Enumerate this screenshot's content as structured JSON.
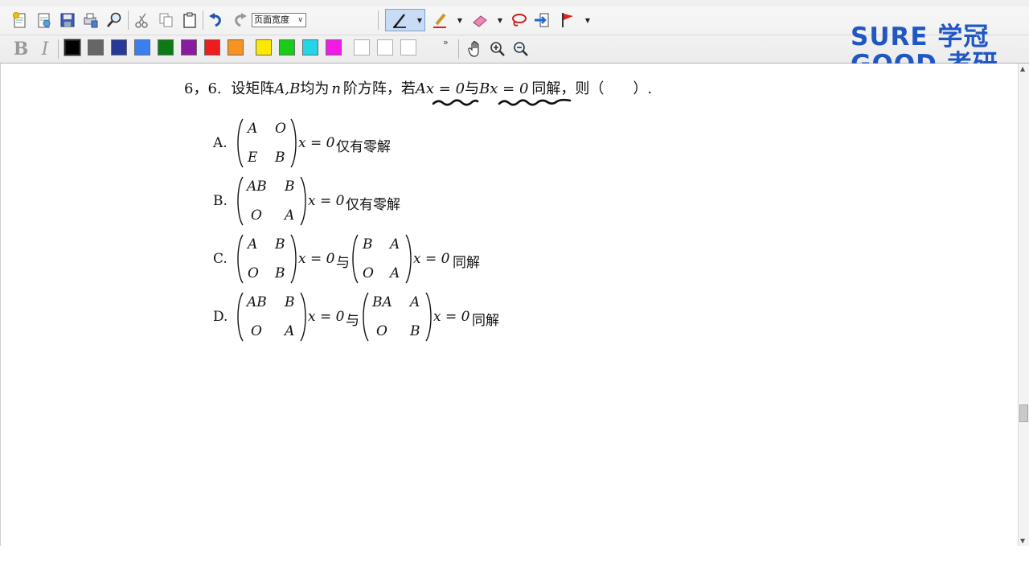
{
  "toolbar": {
    "zoom_selected": "页面宽度",
    "colors": [
      "#000000",
      "#666666",
      "#27389b",
      "#3a7ff0",
      "#0d7a17",
      "#8c1aa0",
      "#ee1c1c",
      "#f7931e",
      "#ffe800",
      "#18cc18",
      "#22d6e8",
      "#f21be6"
    ],
    "more_symbol": "»",
    "bold_label": "B",
    "italic_label": "I"
  },
  "logo": {
    "line1_en": "SURE",
    "line1_cn": "学冠",
    "line2_en": "GOOD",
    "line2_cn": "考研",
    "color": "#1f57c3"
  },
  "question": {
    "number": "6，6.",
    "stem_1": "设矩阵",
    "AB": "A,B",
    "stem_2": "均为",
    "n": "n",
    "stem_3": "阶方阵，若",
    "eq1": "Ax = 0",
    "with": "与",
    "eq2": "Bx = 0",
    "stem_4": "同解，则（　　）."
  },
  "options": [
    {
      "label": "A.",
      "matrix": [
        "A",
        "O",
        "E",
        "B"
      ],
      "eq": "x = 0",
      "tail": "仅有零解"
    },
    {
      "label": "B.",
      "matrix": [
        "AB",
        "B",
        "O",
        "A"
      ],
      "eq": "x = 0",
      "tail": "仅有零解"
    },
    {
      "label": "C.",
      "matrix": [
        "A",
        "B",
        "O",
        "B"
      ],
      "eq": "x = 0",
      "mid": "与",
      "matrix2": [
        "B",
        "A",
        "O",
        "A"
      ],
      "eq2": "x = 0",
      "tail": "同解"
    },
    {
      "label": "D.",
      "matrix": [
        "AB",
        "B",
        "O",
        "A"
      ],
      "eq": "x = 0",
      "mid": "与",
      "matrix2": [
        "BA",
        "A",
        "O",
        "B"
      ],
      "eq2": "x = 0",
      "tail": "同解"
    }
  ]
}
